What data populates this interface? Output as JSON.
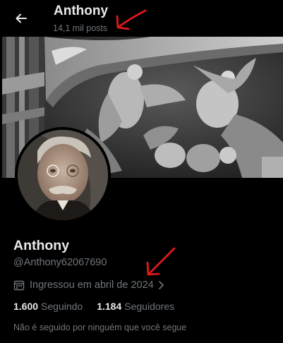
{
  "header": {
    "name": "Anthony",
    "posts_count": "14,1 mil posts"
  },
  "profile": {
    "display_name": "Anthony",
    "handle": "@Anthony62067690",
    "joined": "Ingressou em abril de 2024",
    "following_count": "1.600",
    "following_label": "Seguindo",
    "followers_count": "1.184",
    "followers_label": "Seguidores",
    "followed_by_note": "Não é seguido por ninguém que você segue"
  },
  "icons": {
    "back": "arrow-left-icon",
    "calendar": "calendar-icon",
    "chevron": "chevron-right-icon"
  },
  "colors": {
    "background": "#000000",
    "primary_text": "#e7e9ea",
    "secondary_text": "#71767b",
    "annotation": "#e01818"
  }
}
